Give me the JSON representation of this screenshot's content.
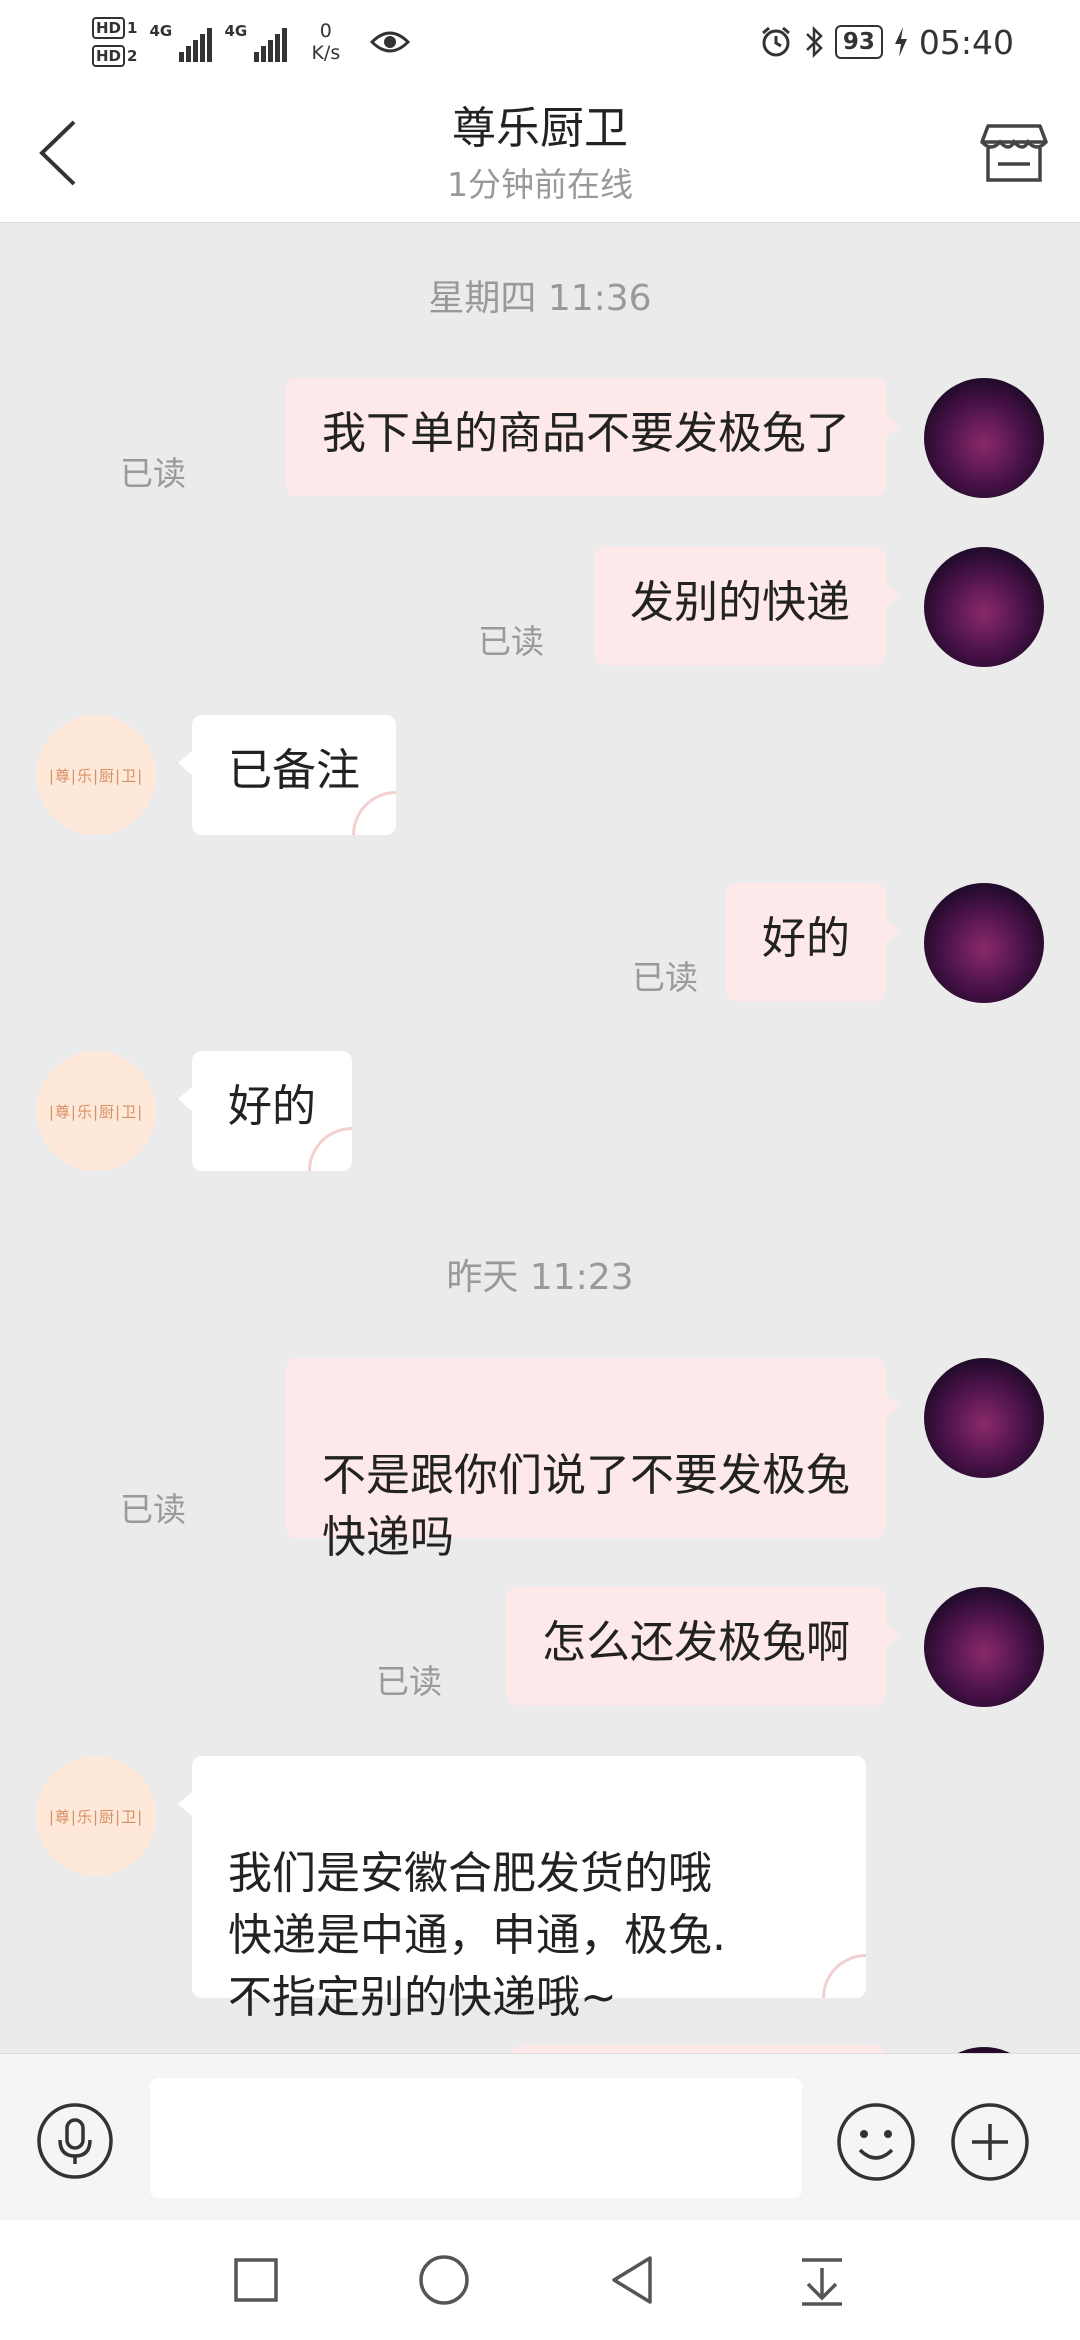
{
  "status_bar": {
    "sim1": "HD",
    "sim1_num": "1",
    "sim2": "HD",
    "sim2_num": "2",
    "network1": "4G",
    "network2": "4G",
    "speed_value": "0",
    "speed_unit": "K/s",
    "battery": "93",
    "time": "05:40"
  },
  "header": {
    "title": "尊乐厨卫",
    "subtitle": "1分钟前在线"
  },
  "shop_avatar_text": "|尊|乐|厨|卫|",
  "chat": {
    "timestamps": [
      "星期四 11:36",
      "昨天 11:23"
    ],
    "read_label": "已读",
    "messages": [
      {
        "sender": "me",
        "text": "我下单的商品不要发极兔了",
        "read": true
      },
      {
        "sender": "me",
        "text": "发别的快递",
        "read": true
      },
      {
        "sender": "shop",
        "text": "已备注"
      },
      {
        "sender": "me",
        "text": "好的",
        "read": true
      },
      {
        "sender": "shop",
        "text": "好的"
      },
      {
        "sender": "me",
        "text": "不是跟你们说了不要发极兔\n快递吗",
        "read": true
      },
      {
        "sender": "me",
        "text": "怎么还发极兔啊",
        "read": true
      },
      {
        "sender": "shop",
        "text": "我们是安徽合肥发货的哦\n快递是中通，申通，极兔.\n不指定别的快递哦~"
      }
    ]
  },
  "input": {
    "placeholder": ""
  },
  "icons": {
    "back": "back-arrow-icon",
    "shop": "store-icon",
    "voice": "microphone-icon",
    "emoji": "smiley-icon",
    "plus": "plus-icon",
    "nav": [
      "square-icon",
      "circle-icon",
      "triangle-back-icon",
      "notification-pull-icon"
    ]
  },
  "colors": {
    "outgoing_bubble": "#fde9e9",
    "incoming_bubble": "#ffffff",
    "background": "#ebebeb"
  }
}
